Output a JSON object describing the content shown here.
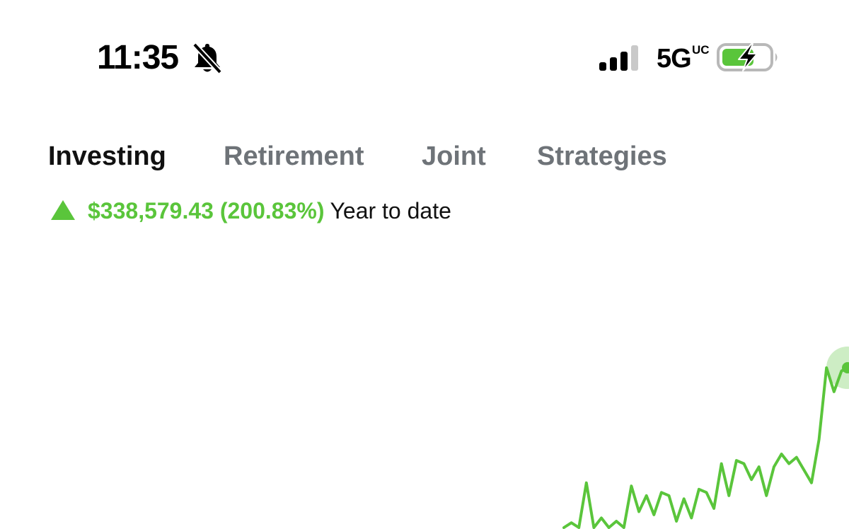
{
  "status_bar": {
    "time": "11:35",
    "network": "5G",
    "network_badge": "UC",
    "icons": [
      "bell-slash-icon",
      "cellular-signal-icon",
      "battery-charging-icon"
    ]
  },
  "tabs": [
    {
      "label": "Investing",
      "active": true
    },
    {
      "label": "Retirement",
      "active": false
    },
    {
      "label": "Joint",
      "active": false
    },
    {
      "label": "Strategies",
      "active": false
    }
  ],
  "performance": {
    "direction_icon": "triangle-up-icon",
    "change": "$338,579.43 (200.83%)",
    "period": "Year to date"
  },
  "colors": {
    "gain_green": "#5ac53b",
    "tab_inactive": "#6e7378",
    "tab_active": "#111111"
  },
  "chart_data": {
    "type": "line",
    "values": [
      0.0,
      0.03,
      0.0,
      0.28,
      0.0,
      0.06,
      0.0,
      0.04,
      0.0,
      0.26,
      0.1,
      0.2,
      0.08,
      0.22,
      0.2,
      0.04,
      0.18,
      0.06,
      0.24,
      0.22,
      0.12,
      0.4,
      0.2,
      0.42,
      0.4,
      0.3,
      0.38,
      0.2,
      0.38,
      0.46,
      0.4,
      0.44,
      0.36,
      0.28,
      0.55,
      1.0,
      0.85,
      0.98,
      1.0
    ]
  }
}
